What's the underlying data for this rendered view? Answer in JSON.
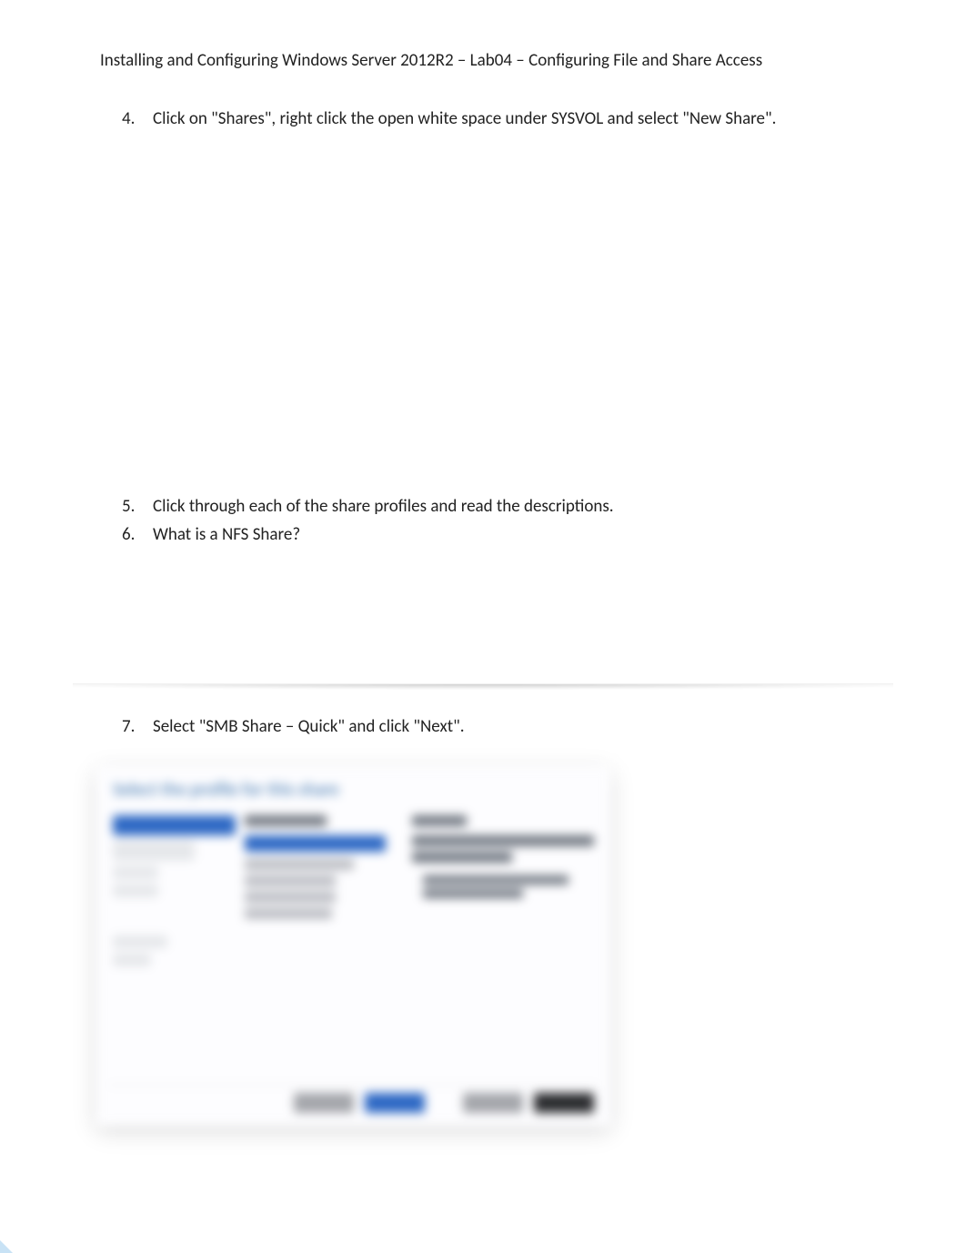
{
  "doc": {
    "title": "Installing and Configuring Windows Server 2012R2 – Lab04 – Configuring File and Share Access"
  },
  "steps": {
    "s4": {
      "num": "4.",
      "text": "Click on \"Shares\", right click the open white space under SYSVOL and select \"New Share\"."
    },
    "s5": {
      "num": "5.",
      "text": "Click through each of the share profiles and read the descriptions."
    },
    "s6": {
      "num": "6.",
      "text": "What is a NFS Share?"
    },
    "s7": {
      "num": "7.",
      "text": "Select \"SMB Share – Quick\" and click \"Next\"."
    }
  },
  "wizard": {
    "title": "Select the profile for this share",
    "nav": {
      "active": "Select Profile",
      "items": [
        "Share Location",
        "Share Name",
        "Other Settings",
        "Permissions",
        "Confirmation",
        "Results"
      ]
    },
    "profiles_header": "File share profile:",
    "profile_selected": "SMB Share - Quick",
    "profiles": [
      "SMB Share - Quick",
      "SMB Share - Advanced",
      "SMB Share - Applications",
      "NFS Share - Quick",
      "NFS Share - Advanced"
    ],
    "description_header": "Description:",
    "description_body": "This basic profile represents the fastest way to create an SMB file share, typically used to share files with Windows-based computers.",
    "buttons": {
      "previous": "< Previous",
      "next": "Next >",
      "create": "Create",
      "cancel": "Cancel"
    }
  }
}
